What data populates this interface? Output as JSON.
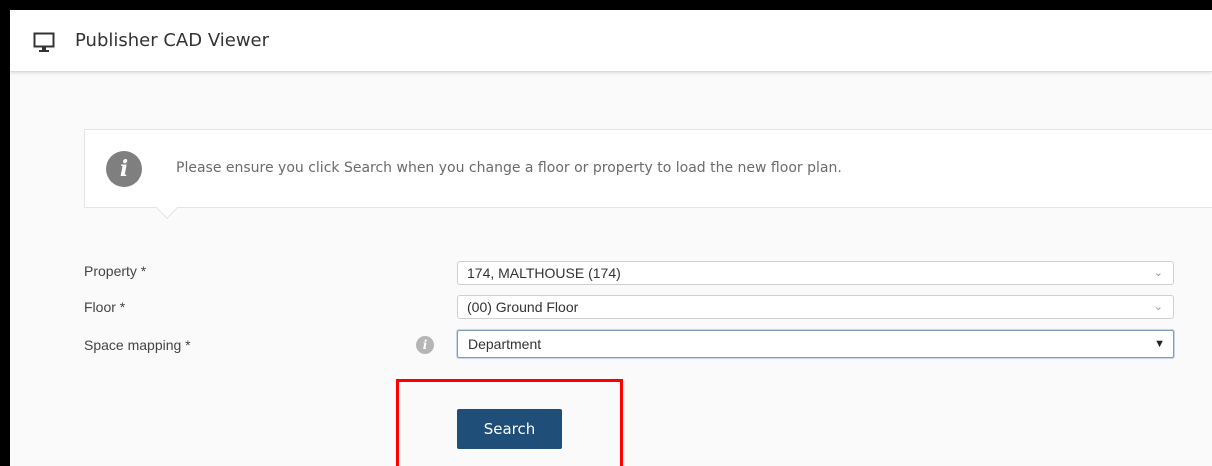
{
  "header": {
    "title": "Publisher CAD Viewer",
    "icon": "monitor-icon"
  },
  "notice": {
    "icon": "info-icon",
    "message": "Please ensure you click Search when you change a floor or property to load the new floor plan."
  },
  "form": {
    "property_label": "Property *",
    "property_value": "174, MALTHOUSE (174)",
    "floor_label": "Floor *",
    "floor_value": "(00) Ground Floor",
    "space_mapping_label": "Space mapping *",
    "space_mapping_value": "Department",
    "space_mapping_help_icon": "info-icon"
  },
  "actions": {
    "search_label": "Search"
  },
  "colors": {
    "primary_button": "#1f4e79",
    "highlight_box": "#ff0000",
    "info_icon": "#7f7f7f"
  }
}
